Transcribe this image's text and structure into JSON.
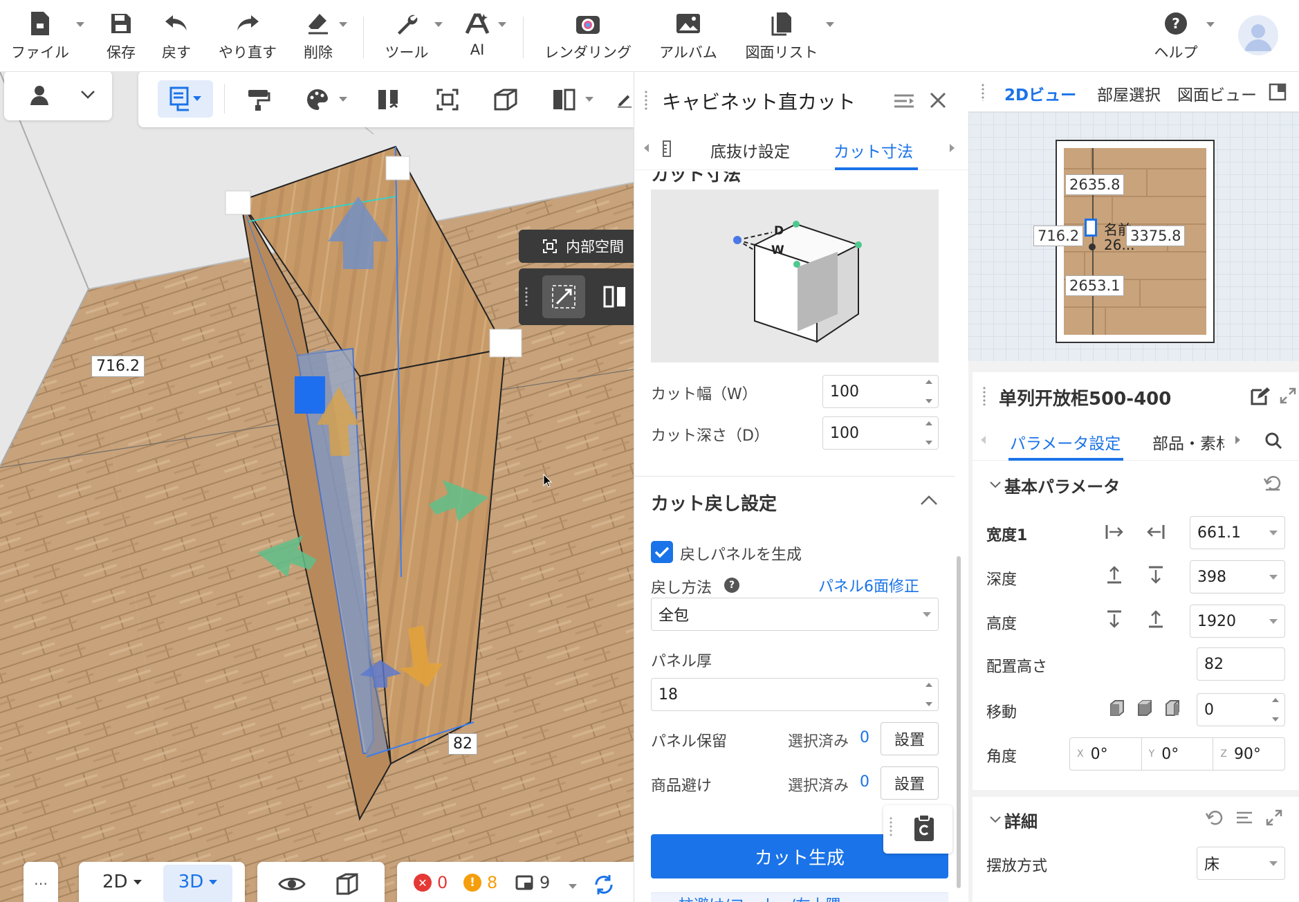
{
  "toolbar": {
    "items": [
      {
        "label": "ファイル",
        "icon": "file-icon"
      },
      {
        "label": "保存",
        "icon": "save-icon"
      },
      {
        "label": "戻す",
        "icon": "undo-icon"
      },
      {
        "label": "やり直す",
        "icon": "redo-icon"
      },
      {
        "label": "削除",
        "icon": "eraser-icon"
      },
      {
        "label": "ツール",
        "icon": "wrench-icon"
      },
      {
        "label": "AI",
        "icon": "ai-icon"
      },
      {
        "label": "レンダリング",
        "icon": "camera-icon"
      },
      {
        "label": "アルバム",
        "icon": "album-icon"
      },
      {
        "label": "図面リスト",
        "icon": "drawing-list-icon"
      },
      {
        "label": "ヘルプ",
        "icon": "help-icon"
      }
    ]
  },
  "viewport": {
    "dim_left": "716.2",
    "dim_bottom": "82",
    "inner_space_label": "内部空間",
    "view_2d": "2D",
    "view_3d": "3D",
    "more_label": "…",
    "status": {
      "errors": "0",
      "warnings": "8",
      "items": "9"
    }
  },
  "cut_panel": {
    "title": "キャビネット直カット",
    "tabs": [
      "底抜け設定",
      "カット寸法"
    ],
    "active_tab": "カット寸法",
    "section_partial": "カット寸法",
    "diagram_labels": {
      "d": "D",
      "w": "W"
    },
    "cut_width_label": "カット幅（W）",
    "cut_width_value": "100",
    "cut_depth_label": "カット深さ（D）",
    "cut_depth_value": "100",
    "return_section_title": "カット戻し設定",
    "generate_panel_label": "戻しパネルを生成",
    "generate_panel_checked": true,
    "return_method_label": "戻し方法",
    "panel_6face_link": "パネル6面修正",
    "return_method_value": "全包",
    "panel_thickness_label": "パネル厚",
    "panel_thickness_value": "18",
    "panel_keep_label": "パネル保留",
    "panel_keep_selected": "選択済み",
    "panel_keep_count": "0",
    "panel_keep_button": "設置",
    "product_avoid_label": "商品避け",
    "product_avoid_selected": "選択済み",
    "product_avoid_count": "0",
    "product_avoid_button": "設置",
    "generate_button": "カット生成",
    "bottom_partial": "柱避け/コーナー/左上隅"
  },
  "view_panel": {
    "tabs": [
      "2Dビュー",
      "部屋選択",
      "図面ビュー"
    ],
    "active_tab": "2Dビュー",
    "dims": {
      "top": "2635.8",
      "left": "716.2",
      "right": "3375.8",
      "bottom": "2653.1"
    },
    "name_partial": "名前",
    "value_partial": "26..."
  },
  "props_panel": {
    "title": "单列开放柜500-400",
    "tabs": [
      "パラメータ設定",
      "部品・素材"
    ],
    "active_tab": "パラメータ設定",
    "basic_section": "基本パラメータ",
    "params": [
      {
        "label": "宽度1",
        "value": "661.1"
      },
      {
        "label": "深度",
        "value": "398"
      },
      {
        "label": "高度",
        "value": "1920"
      },
      {
        "label": "配置高さ",
        "value": "82"
      },
      {
        "label": "移動",
        "value": "0"
      }
    ],
    "angle_label": "角度",
    "angle": {
      "x_label": "X",
      "x": "0°",
      "y_label": "Y",
      "y": "0°",
      "z_label": "Z",
      "z": "90°"
    },
    "detail_section": "詳細",
    "placement_label": "摆放方式",
    "placement_value": "床"
  },
  "colors": {
    "accent": "#1a73e8",
    "error": "#e53935",
    "warning": "#f59e0b"
  }
}
